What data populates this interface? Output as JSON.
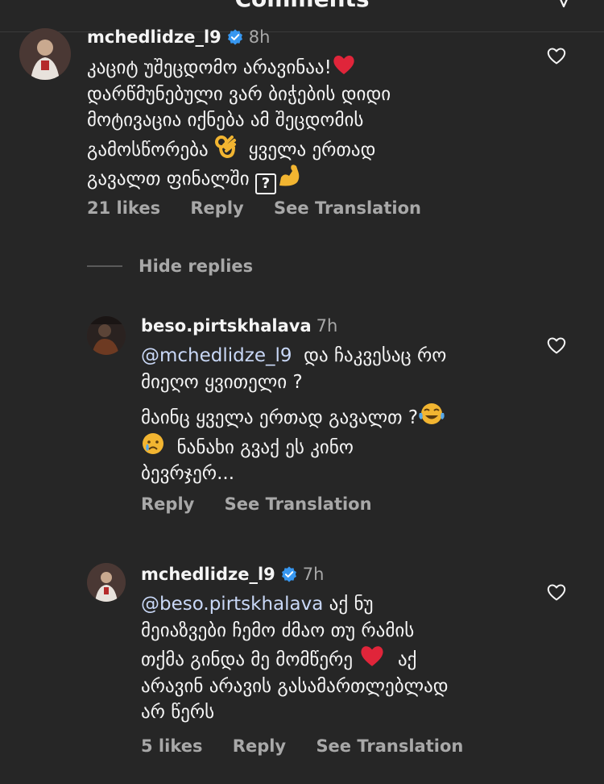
{
  "header": {
    "title": "Comments"
  },
  "comments": [
    {
      "username": "mchedlidze_l9",
      "time": "8h",
      "lines": [
        "კაციტ უშეცდომო არავინაა!",
        "დარწმუნებული ვარ ბიჭების დიდი",
        "მოტივაცია იქნება ამ შეცდომის",
        "გამოსწორება",
        "ყველა ერთად",
        "გავალთ ფინალში"
      ],
      "likes": "21 likes",
      "reply": "Reply",
      "translation": "See Translation"
    }
  ],
  "hide_replies": "Hide replies",
  "replies": [
    {
      "username": "beso.pirtskhalava",
      "time": "7h",
      "mention": "@mchedlidze_l9",
      "text_a": "და ჩაკვესაც რო",
      "text_b": "მიეღო ყვითელი ?",
      "text_c": "მაინც ყველა ერთად გავალთ ?",
      "text_d": "ნანახი გვაქ ეს კინო",
      "text_e": "ბევრჯერ...",
      "reply": "Reply",
      "translation": "See Translation"
    },
    {
      "username": "mchedlidze_l9",
      "time": "7h",
      "mention": "@beso.pirtskhalava",
      "text_a": "აქ ნუ",
      "text_b": "მეიაზვები ჩემო ძმაო თუ რამის",
      "text_c": "თქმა გინდა მე მომწერე",
      "text_d": "აქ",
      "text_e": "არავინ არავის გასამართლებლად",
      "text_f": "არ წერს",
      "likes": "5 likes",
      "reply": "Reply",
      "translation": "See Translation"
    }
  ],
  "colors": {
    "background": "#262626",
    "muted": "#a8a8a8",
    "mention": "#c9d8f7",
    "verified": "#3797f0",
    "heart_red": "#e0253a"
  },
  "icons": [
    "verified-badge-icon",
    "heart-outline-icon",
    "red-heart-emoji",
    "ok-hand-emoji",
    "flexed-biceps-emoji",
    "tears-of-joy-emoji",
    "crying-face-emoji",
    "unknown-glyph-box"
  ]
}
